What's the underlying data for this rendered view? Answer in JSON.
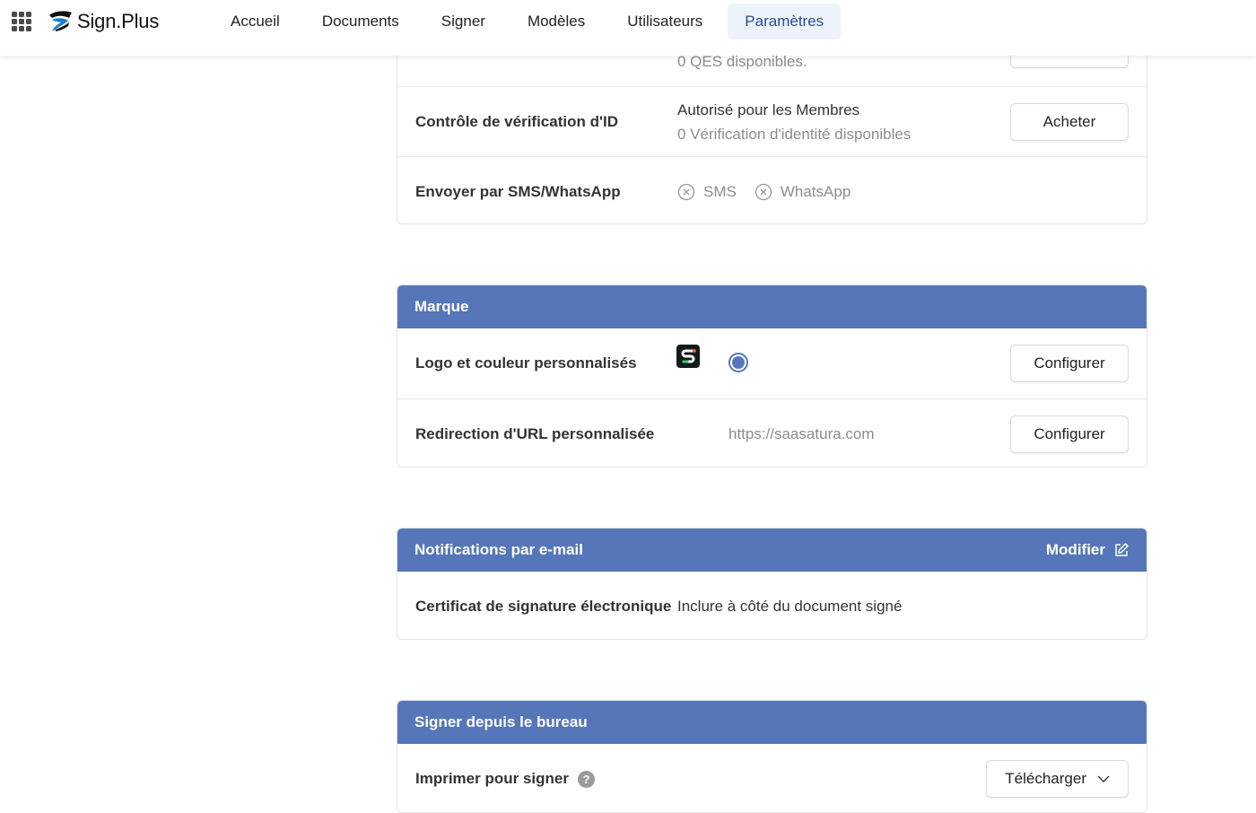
{
  "app": {
    "name": "Sign.Plus"
  },
  "nav": {
    "items": [
      {
        "label": "Accueil"
      },
      {
        "label": "Documents"
      },
      {
        "label": "Signer"
      },
      {
        "label": "Modèles"
      },
      {
        "label": "Utilisateurs"
      },
      {
        "label": "Paramètres",
        "active": true
      }
    ]
  },
  "security": {
    "partial_row_value": "0 QES disponibles.",
    "id_check": {
      "label": "Contrôle de vérification d'ID",
      "value1": "Autorisé pour les Membres",
      "value2": "0 Vérification d'identité disponibles",
      "button": "Acheter"
    },
    "sms": {
      "label": "Envoyer par SMS/WhatsApp",
      "option1": "SMS",
      "option2": "WhatsApp"
    }
  },
  "brand": {
    "title": "Marque",
    "logo_row": {
      "label": "Logo et couleur personnalisés",
      "button": "Configurer",
      "color": "#5576b8"
    },
    "url_row": {
      "label": "Redirection d'URL personnalisée",
      "value": "https://saasatura.com",
      "button": "Configurer"
    }
  },
  "notifications": {
    "title": "Notifications par e-mail",
    "edit_label": "Modifier",
    "row": {
      "label": "Certificat de signature électronique",
      "value": "Inclure à côté du document signé"
    }
  },
  "desktop": {
    "title": "Signer depuis le bureau",
    "row": {
      "label": "Imprimer pour signer",
      "button": "Télécharger"
    }
  },
  "colors": {
    "header": "#5576b8",
    "nav_active_bg": "#eef3fb"
  }
}
